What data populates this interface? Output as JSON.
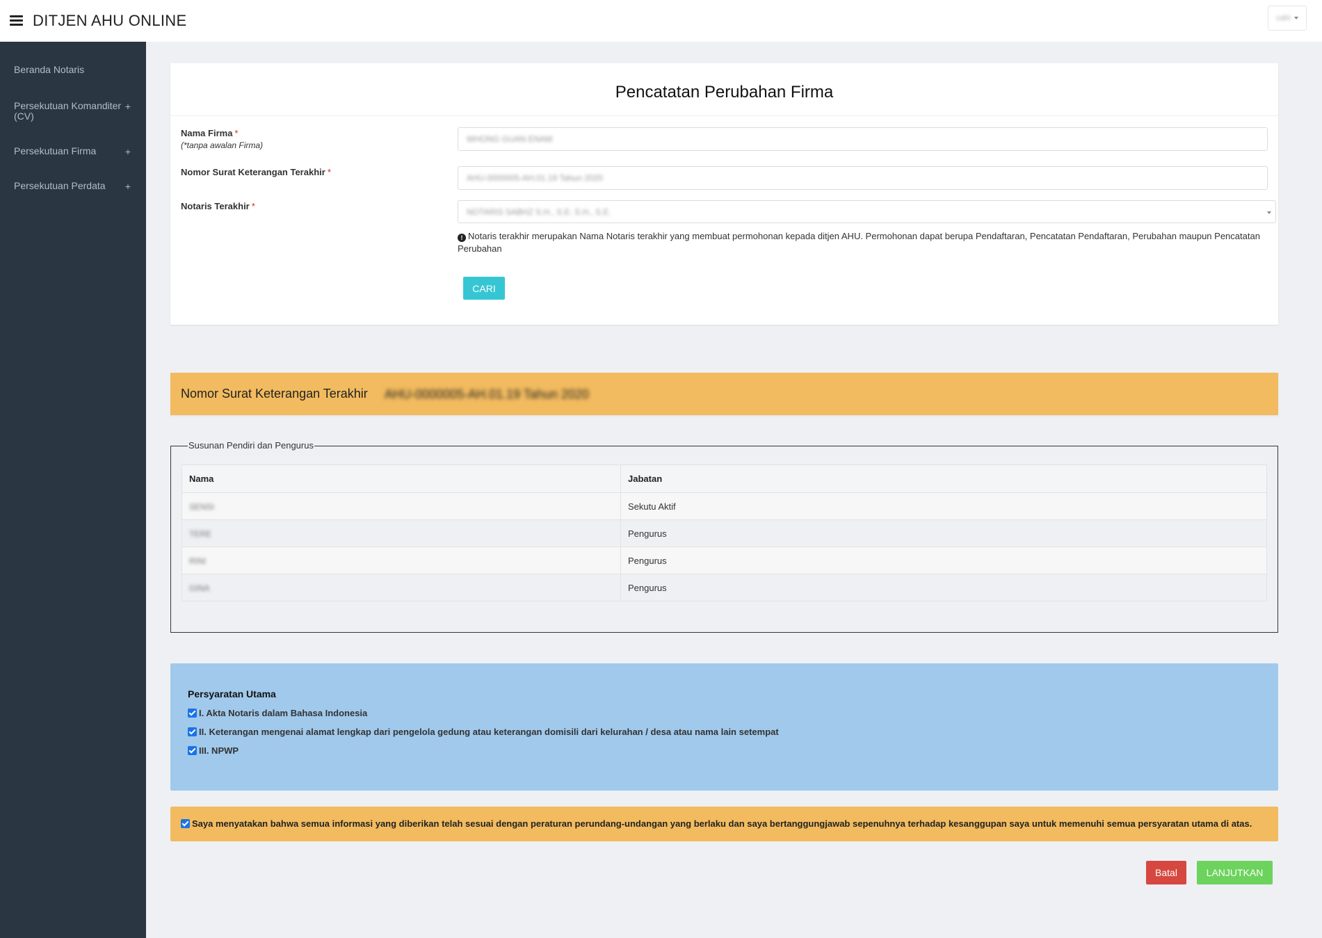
{
  "header": {
    "app_title": "DITJEN AHU ONLINE",
    "user_name": "cahi"
  },
  "sidebar": {
    "items": [
      {
        "label": "Beranda Notaris",
        "expandable": false
      },
      {
        "label": "Persekutuan Komanditer (CV)",
        "expandable": true
      },
      {
        "label": "Persekutuan Firma",
        "expandable": true
      },
      {
        "label": "Persekutuan Perdata",
        "expandable": true
      }
    ],
    "expand_symbol": "+"
  },
  "form": {
    "title": "Pencatatan Perubahan Firma",
    "required_mark": "*",
    "nama_firma": {
      "label": "Nama Firma",
      "sublabel": "(*tanpa awalan Firma)",
      "value": "WHONG GUAN ENAM"
    },
    "nomor_surat": {
      "label": "Nomor Surat Keterangan Terakhir",
      "value": "AHU-0000005-AH.01.19 Tahun 2020"
    },
    "notaris": {
      "label": "Notaris Terakhir",
      "value": "NOTARIS SABHZ S.H., S.E. S.H., S.E."
    },
    "help_icon": "info-icon",
    "help_text": "Notaris terakhir merupakan Nama Notaris terakhir yang membuat permohonan kepada ditjen AHU. Permohonan dapat berupa Pendaftaran, Pencatatan Pendaftaran, Perubahan maupun Pencatatan Perubahan",
    "search_button": "CARI"
  },
  "banner": {
    "label": "Nomor Surat Keterangan Terakhir",
    "value": "AHU-0000005-AH.01.19 Tahun 2020"
  },
  "founders": {
    "legend": "Susunan Pendiri dan Pengurus",
    "columns": [
      "Nama",
      "Jabatan"
    ],
    "rows": [
      {
        "nama": "SENSI",
        "jabatan": "Sekutu Aktif"
      },
      {
        "nama": "TERE",
        "jabatan": "Pengurus"
      },
      {
        "nama": "RINI",
        "jabatan": "Pengurus"
      },
      {
        "nama": "GINA",
        "jabatan": "Pengurus"
      }
    ]
  },
  "requirements": {
    "title": "Persyaratan Utama",
    "items": [
      {
        "label": "I. Akta Notaris dalam Bahasa Indonesia",
        "checked": true
      },
      {
        "label": "II. Keterangan mengenai alamat lengkap dari pengelola gedung atau keterangan domisili dari kelurahan / desa atau nama lain setempat",
        "checked": true
      },
      {
        "label": "III. NPWP",
        "checked": true
      }
    ]
  },
  "agreement": {
    "label": "Saya menyatakan bahwa semua informasi yang diberikan telah sesuai dengan peraturan perundang-undangan yang berlaku dan saya bertanggungjawab sepenuhnya terhadap kesanggupan saya untuk memenuhi semua persyaratan utama di atas.",
    "checked": true
  },
  "actions": {
    "cancel": "Batal",
    "continue": "LANJUTKAN"
  },
  "colors": {
    "sidebar_bg": "#2b3643",
    "banner_bg": "#f2bb5f",
    "requirements_bg": "#a0c9ec",
    "search_button": "#36c6d3",
    "cancel_button": "#d64740",
    "continue_button": "#6cd35c"
  }
}
